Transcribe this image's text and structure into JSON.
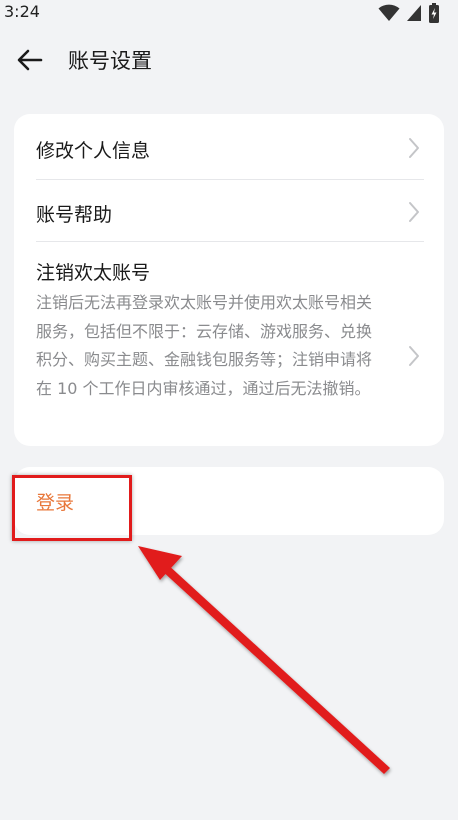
{
  "status_bar": {
    "time": "3:24",
    "icons": [
      "wifi-icon",
      "signal-icon",
      "battery-icon"
    ]
  },
  "header": {
    "back_icon": "arrow-left-icon",
    "title": "账号设置"
  },
  "settings": {
    "items": [
      {
        "label": "修改个人信息"
      },
      {
        "label": "账号帮助"
      },
      {
        "label": "注销欢太账号",
        "description": "注销后无法再登录欢太账号并使用欢太账号相关服务，包括但不限于：云存储、游戏服务、兑换积分、购买主题、金融钱包服务等；注销申请将在 10 个工作日内审核通过，通过后无法撤销。"
      }
    ]
  },
  "login": {
    "label": "登录"
  },
  "colors": {
    "background": "#f2f3f5",
    "card": "#ffffff",
    "accent": "#e8773a",
    "annotation": "#e11b1b"
  }
}
